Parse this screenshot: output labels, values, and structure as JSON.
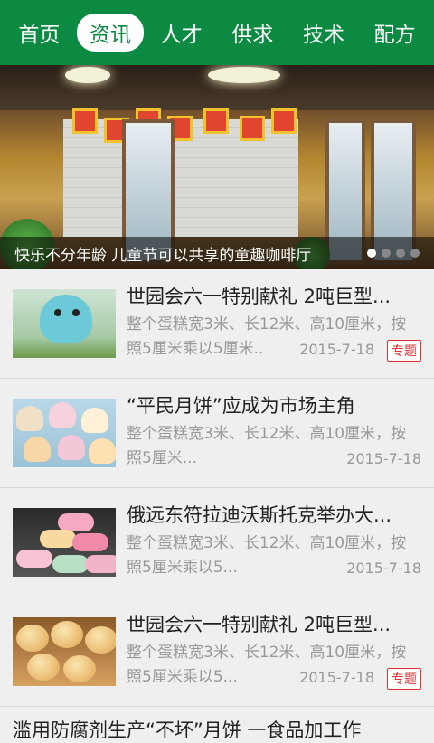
{
  "nav": {
    "items": [
      {
        "label": "首页",
        "active": false
      },
      {
        "label": "资讯",
        "active": true
      },
      {
        "label": "人才",
        "active": false
      },
      {
        "label": "供求",
        "active": false
      },
      {
        "label": "技术",
        "active": false
      },
      {
        "label": "配方",
        "active": false
      }
    ],
    "accent_color": "#0d8a42"
  },
  "banner": {
    "caption": "快乐不分年龄 儿童节可以共享的童趣咖啡厅",
    "slide_count": 4,
    "active_slide": 1
  },
  "articles": [
    {
      "title": "世园会六一特别献礼 2吨巨型...",
      "desc": "整个蛋糕宽3米、长12米、高10厘米，按照5厘米乘以5厘米..",
      "date": "2015-7-18",
      "tag": "专题",
      "thumb_icon": "mascot-image"
    },
    {
      "title": "“平民月饼”应成为市场主角",
      "desc": "整个蛋糕宽3米、长12米、高10厘米，按照5厘米...",
      "date": "2015-7-18",
      "tag": "",
      "thumb_icon": "cupcakes-image"
    },
    {
      "title": "俄远东符拉迪沃斯托克举办大...",
      "desc": "整个蛋糕宽3米、长12米、高10厘米，按照5厘米乘以5...",
      "date": "2015-7-18",
      "tag": "",
      "thumb_icon": "macarons-image"
    },
    {
      "title": "世园会六一特别献礼 2吨巨型...",
      "desc": "整个蛋糕宽3米、长12米、高10厘米，按照5厘米乘以5...",
      "date": "2015-7-18",
      "tag": "专题",
      "thumb_icon": "buns-image"
    }
  ],
  "peek_title": "滥用防腐剂生产“不坏”月饼 一食品加工作"
}
